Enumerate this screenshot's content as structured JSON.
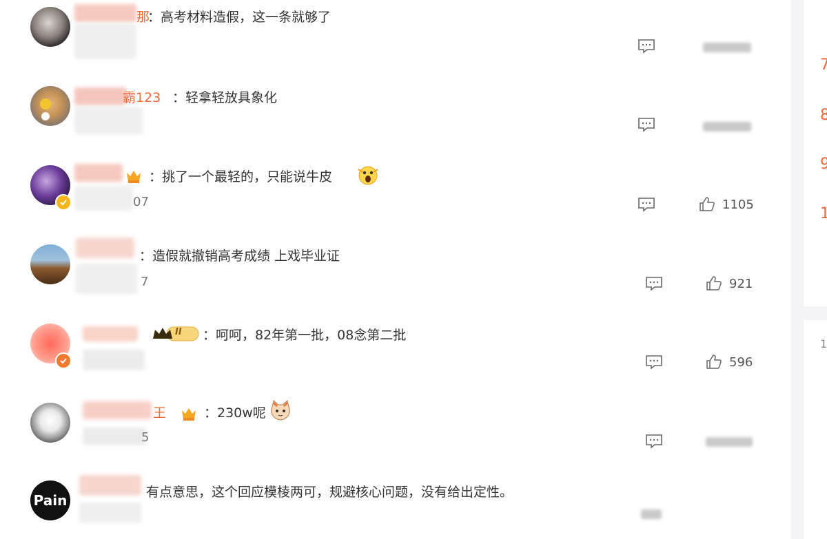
{
  "comments": [
    {
      "name_tail": "那",
      "text": "：高考材料造假，这一条就够了",
      "date_tail": "",
      "likes": ""
    },
    {
      "name_tail": "霸123",
      "text": "：轻拿轻放具象化",
      "date_tail": "",
      "likes": ""
    },
    {
      "name_tail": "",
      "text": "：挑了一个最轻的，只能说牛皮",
      "date_tail": "07",
      "likes": "1105"
    },
    {
      "name_tail": "",
      "text": "：造假就撤销高考成绩 上戏毕业证",
      "date_tail": "7",
      "likes": "921"
    },
    {
      "name_tail": "",
      "text": "：呵呵，82年第一批，08念第二批",
      "date_tail": "",
      "likes": "596"
    },
    {
      "name_tail": "王",
      "text": "：230w呢",
      "date_tail": "5",
      "likes": ""
    },
    {
      "name_tail": "",
      "text": "有点意思，这个回应模棱两可，规避核心问题，没有给出定性。",
      "date_tail": "",
      "likes": ""
    }
  ],
  "avatar_text": {
    "pain": "Pain"
  },
  "badges": {
    "level": "II"
  },
  "right_rail": {
    "numbers": [
      "7",
      "8",
      "9",
      "1"
    ]
  },
  "icons": [
    "reply-icon",
    "thumb-up-icon",
    "verified-icon",
    "crown-icon",
    "vip-icon",
    "cat-emoji-icon",
    "scream-emoji-icon"
  ],
  "colors": {
    "name_accent": "#ef6b3a",
    "text": "#333333",
    "meta": "#777777",
    "verified": "#f5b51b"
  }
}
